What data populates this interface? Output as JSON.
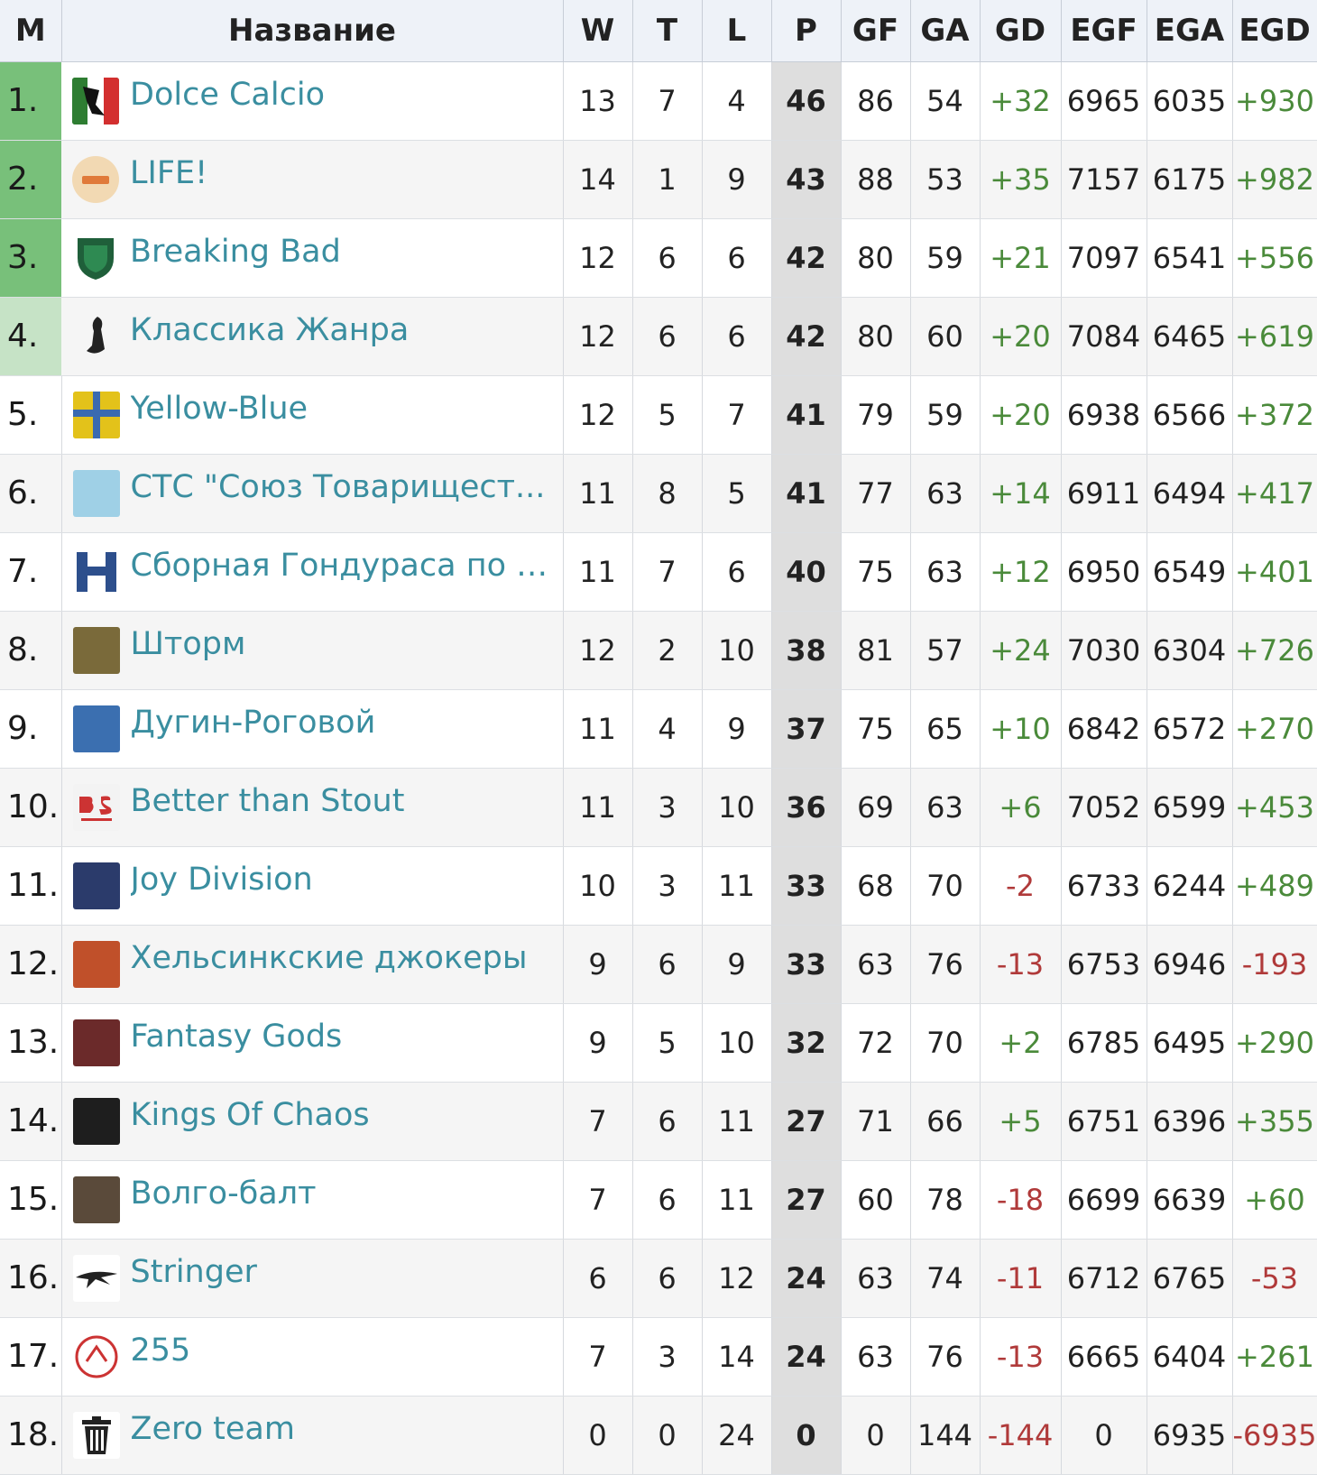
{
  "headers": {
    "pos": "M",
    "name": "Название",
    "w": "W",
    "t": "T",
    "l": "L",
    "p": "P",
    "gf": "GF",
    "ga": "GA",
    "gd": "GD",
    "egf": "EGF",
    "ega": "EGA",
    "egd": "EGD"
  },
  "rows": [
    {
      "pos": "1.",
      "name": "Dolce Calcio",
      "w": "13",
      "t": "7",
      "l": "4",
      "p": "46",
      "gf": "86",
      "ga": "54",
      "gd": "+32",
      "egf": "6965",
      "ega": "6035",
      "egd": "+930"
    },
    {
      "pos": "2.",
      "name": "LIFE!",
      "w": "14",
      "t": "1",
      "l": "9",
      "p": "43",
      "gf": "88",
      "ga": "53",
      "gd": "+35",
      "egf": "7157",
      "ega": "6175",
      "egd": "+982"
    },
    {
      "pos": "3.",
      "name": "Breaking Bad",
      "w": "12",
      "t": "6",
      "l": "6",
      "p": "42",
      "gf": "80",
      "ga": "59",
      "gd": "+21",
      "egf": "7097",
      "ega": "6541",
      "egd": "+556"
    },
    {
      "pos": "4.",
      "name": "Классика Жанра",
      "w": "12",
      "t": "6",
      "l": "6",
      "p": "42",
      "gf": "80",
      "ga": "60",
      "gd": "+20",
      "egf": "7084",
      "ega": "6465",
      "egd": "+619"
    },
    {
      "pos": "5.",
      "name": "Yellow-Blue",
      "w": "12",
      "t": "5",
      "l": "7",
      "p": "41",
      "gf": "79",
      "ga": "59",
      "gd": "+20",
      "egf": "6938",
      "ega": "6566",
      "egd": "+372"
    },
    {
      "pos": "6.",
      "name": "СТС \"Союз Товарищест...",
      "w": "11",
      "t": "8",
      "l": "5",
      "p": "41",
      "gf": "77",
      "ga": "63",
      "gd": "+14",
      "egf": "6911",
      "ega": "6494",
      "egd": "+417"
    },
    {
      "pos": "7.",
      "name": "Сборная Гондураса по х...",
      "w": "11",
      "t": "7",
      "l": "6",
      "p": "40",
      "gf": "75",
      "ga": "63",
      "gd": "+12",
      "egf": "6950",
      "ega": "6549",
      "egd": "+401"
    },
    {
      "pos": "8.",
      "name": "Шторм",
      "w": "12",
      "t": "2",
      "l": "10",
      "p": "38",
      "gf": "81",
      "ga": "57",
      "gd": "+24",
      "egf": "7030",
      "ega": "6304",
      "egd": "+726"
    },
    {
      "pos": "9.",
      "name": "Дугин-Роговой",
      "w": "11",
      "t": "4",
      "l": "9",
      "p": "37",
      "gf": "75",
      "ga": "65",
      "gd": "+10",
      "egf": "6842",
      "ega": "6572",
      "egd": "+270"
    },
    {
      "pos": "10.",
      "name": "Better than Stout",
      "w": "11",
      "t": "3",
      "l": "10",
      "p": "36",
      "gf": "69",
      "ga": "63",
      "gd": "+6",
      "egf": "7052",
      "ega": "6599",
      "egd": "+453"
    },
    {
      "pos": "11.",
      "name": "Joy Division",
      "w": "10",
      "t": "3",
      "l": "11",
      "p": "33",
      "gf": "68",
      "ga": "70",
      "gd": "-2",
      "egf": "6733",
      "ega": "6244",
      "egd": "+489"
    },
    {
      "pos": "12.",
      "name": "Хельсинкские джокеры",
      "w": "9",
      "t": "6",
      "l": "9",
      "p": "33",
      "gf": "63",
      "ga": "76",
      "gd": "-13",
      "egf": "6753",
      "ega": "6946",
      "egd": "-193"
    },
    {
      "pos": "13.",
      "name": "Fantasy Gods",
      "w": "9",
      "t": "5",
      "l": "10",
      "p": "32",
      "gf": "72",
      "ga": "70",
      "gd": "+2",
      "egf": "6785",
      "ega": "6495",
      "egd": "+290"
    },
    {
      "pos": "14.",
      "name": "Kings Of Chaos",
      "w": "7",
      "t": "6",
      "l": "11",
      "p": "27",
      "gf": "71",
      "ga": "66",
      "gd": "+5",
      "egf": "6751",
      "ega": "6396",
      "egd": "+355"
    },
    {
      "pos": "15.",
      "name": "Волго-балт",
      "w": "7",
      "t": "6",
      "l": "11",
      "p": "27",
      "gf": "60",
      "ga": "78",
      "gd": "-18",
      "egf": "6699",
      "ega": "6639",
      "egd": "+60"
    },
    {
      "pos": "16.",
      "name": "Stringer",
      "w": "6",
      "t": "6",
      "l": "12",
      "p": "24",
      "gf": "63",
      "ga": "74",
      "gd": "-11",
      "egf": "6712",
      "ega": "6765",
      "egd": "-53"
    },
    {
      "pos": "17.",
      "name": "255",
      "w": "7",
      "t": "3",
      "l": "14",
      "p": "24",
      "gf": "63",
      "ga": "76",
      "gd": "-13",
      "egf": "6665",
      "ega": "6404",
      "egd": "+261"
    },
    {
      "pos": "18.",
      "name": "Zero team",
      "w": "0",
      "t": "0",
      "l": "24",
      "p": "0",
      "gf": "0",
      "ga": "144",
      "gd": "-144",
      "egf": "0",
      "ega": "6935",
      "egd": "-6935"
    }
  ],
  "logos": [
    {
      "icon": "dolce-calcio-logo",
      "color": "#2e7d32"
    },
    {
      "icon": "life-logo",
      "color": "#f2d9b3"
    },
    {
      "icon": "breaking-bad-logo",
      "color": "#1f5f3a"
    },
    {
      "icon": "klassika-zhanra-logo",
      "color": "#444444"
    },
    {
      "icon": "yellow-blue-logo",
      "color": "#e3c21a"
    },
    {
      "icon": "sts-logo",
      "color": "#9fd0e6"
    },
    {
      "icon": "honduras-logo",
      "color": "#2d4f8c"
    },
    {
      "icon": "shtorm-logo",
      "color": "#7a6a3a"
    },
    {
      "icon": "dugin-rogovoy-logo",
      "color": "#3b6fb0"
    },
    {
      "icon": "better-than-stout-logo",
      "color": "#f3f3f3"
    },
    {
      "icon": "joy-division-logo",
      "color": "#2b3b6b"
    },
    {
      "icon": "helsinki-jokers-logo",
      "color": "#c0502a"
    },
    {
      "icon": "fantasy-gods-logo",
      "color": "#6b2a2a"
    },
    {
      "icon": "kings-of-chaos-logo",
      "color": "#1e1e1e"
    },
    {
      "icon": "volgo-balt-logo",
      "color": "#5a4a3a"
    },
    {
      "icon": "stringer-logo",
      "color": "#ffffff"
    },
    {
      "icon": "255-logo",
      "color": "#ffffff"
    },
    {
      "icon": "trash-can-icon",
      "color": "#ffffff"
    }
  ],
  "colors": {
    "link": "#3a8ea0",
    "positive": "#4a8a3a",
    "negative": "#b03a3a",
    "top3_highlight": "#78c07a",
    "fourth_highlight": "#c6e3c6",
    "points_column": "#dedede",
    "header_bg": "#eef2f8"
  }
}
